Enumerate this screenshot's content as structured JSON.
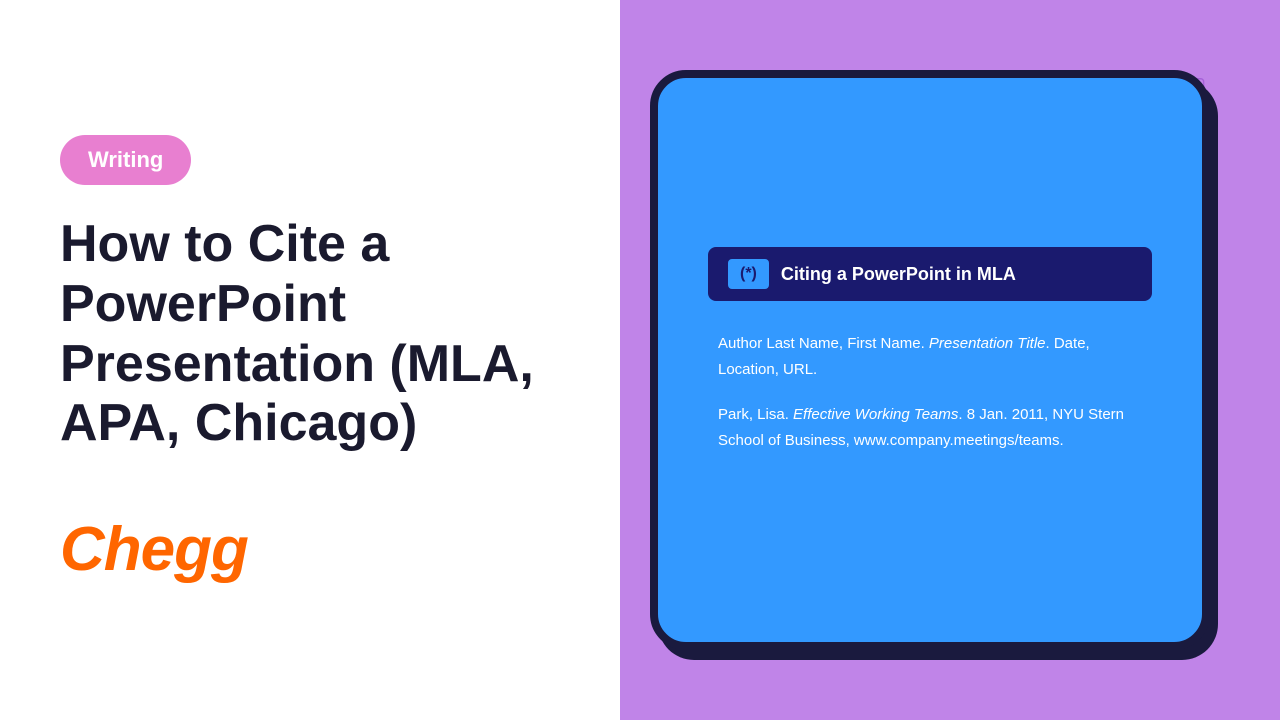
{
  "left": {
    "badge_label": "Writing",
    "main_title": "How to Cite a PowerPoint Presentation (MLA, APA, Chicago)",
    "chegg_logo": "Chegg"
  },
  "right": {
    "slide_title": "Citing a PowerPoint in MLA",
    "asterisk": "(*)",
    "citation_format": "Author Last Name, First Name. Presentation Title. Date, Location, URL.",
    "citation_example": "Park, Lisa. Effective Working Teams. 8 Jan. 2011, NYU Stern School of Business, www.company.meetings/teams."
  },
  "icons": {
    "document": "document",
    "book": "book",
    "file": "file",
    "pen": "pen",
    "list": "list"
  },
  "colors": {
    "badge_bg": "#e87fd0",
    "purple_bg": "#c084e8",
    "blue_card": "#3399ff",
    "title_bar": "#1a1a6e",
    "orange": "#ff6600",
    "text_dark": "#1a1a2e"
  }
}
